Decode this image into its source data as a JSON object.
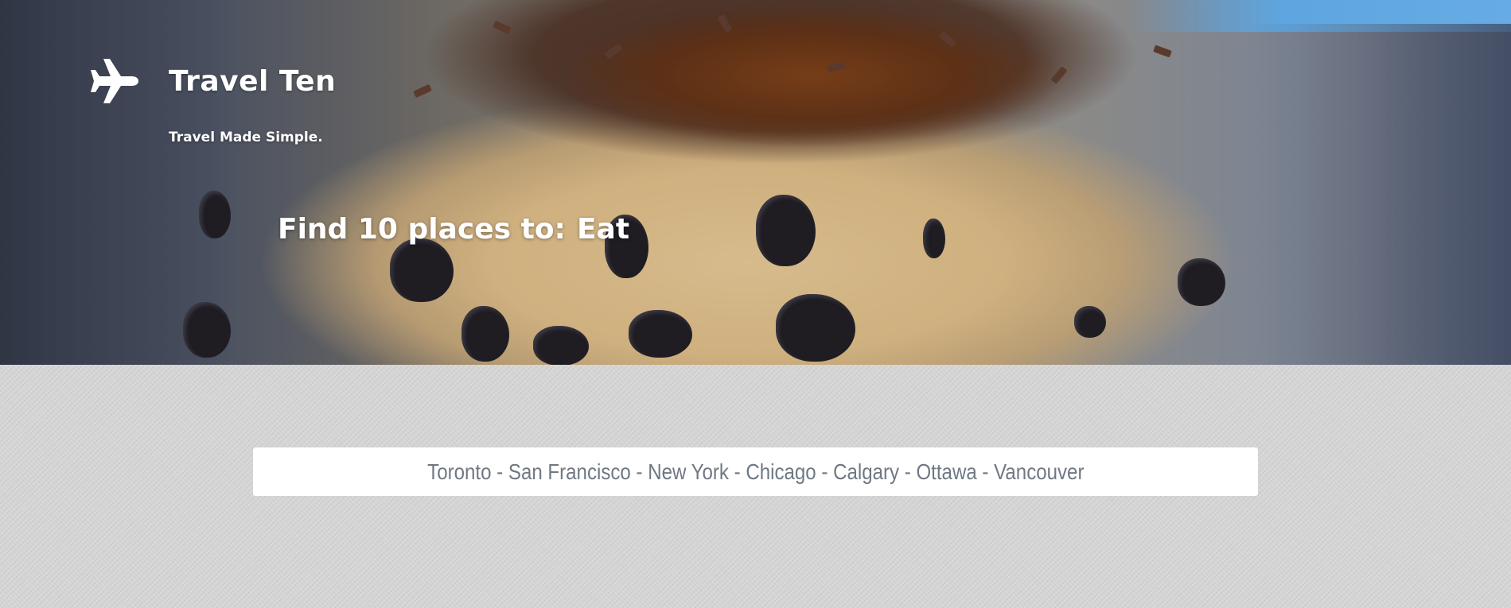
{
  "header": {
    "brand_icon": "airplane-icon",
    "title": "Travel Ten",
    "tagline": "Travel Made Simple."
  },
  "hero": {
    "background_image": "chocolate-chip-cookie-dough-eclair",
    "headline_prefix": "Find 10 places to:",
    "headline_word": "Eat"
  },
  "cities": {
    "text": "Toronto - San Francisco - New York - Chicago - Calgary - Ottawa - Vancouver"
  },
  "colors": {
    "text_on_hero": "#ffffff",
    "lower_background": "#d4d4d4",
    "cities_box_bg": "#ffffff",
    "cities_text": "#6f7883"
  }
}
